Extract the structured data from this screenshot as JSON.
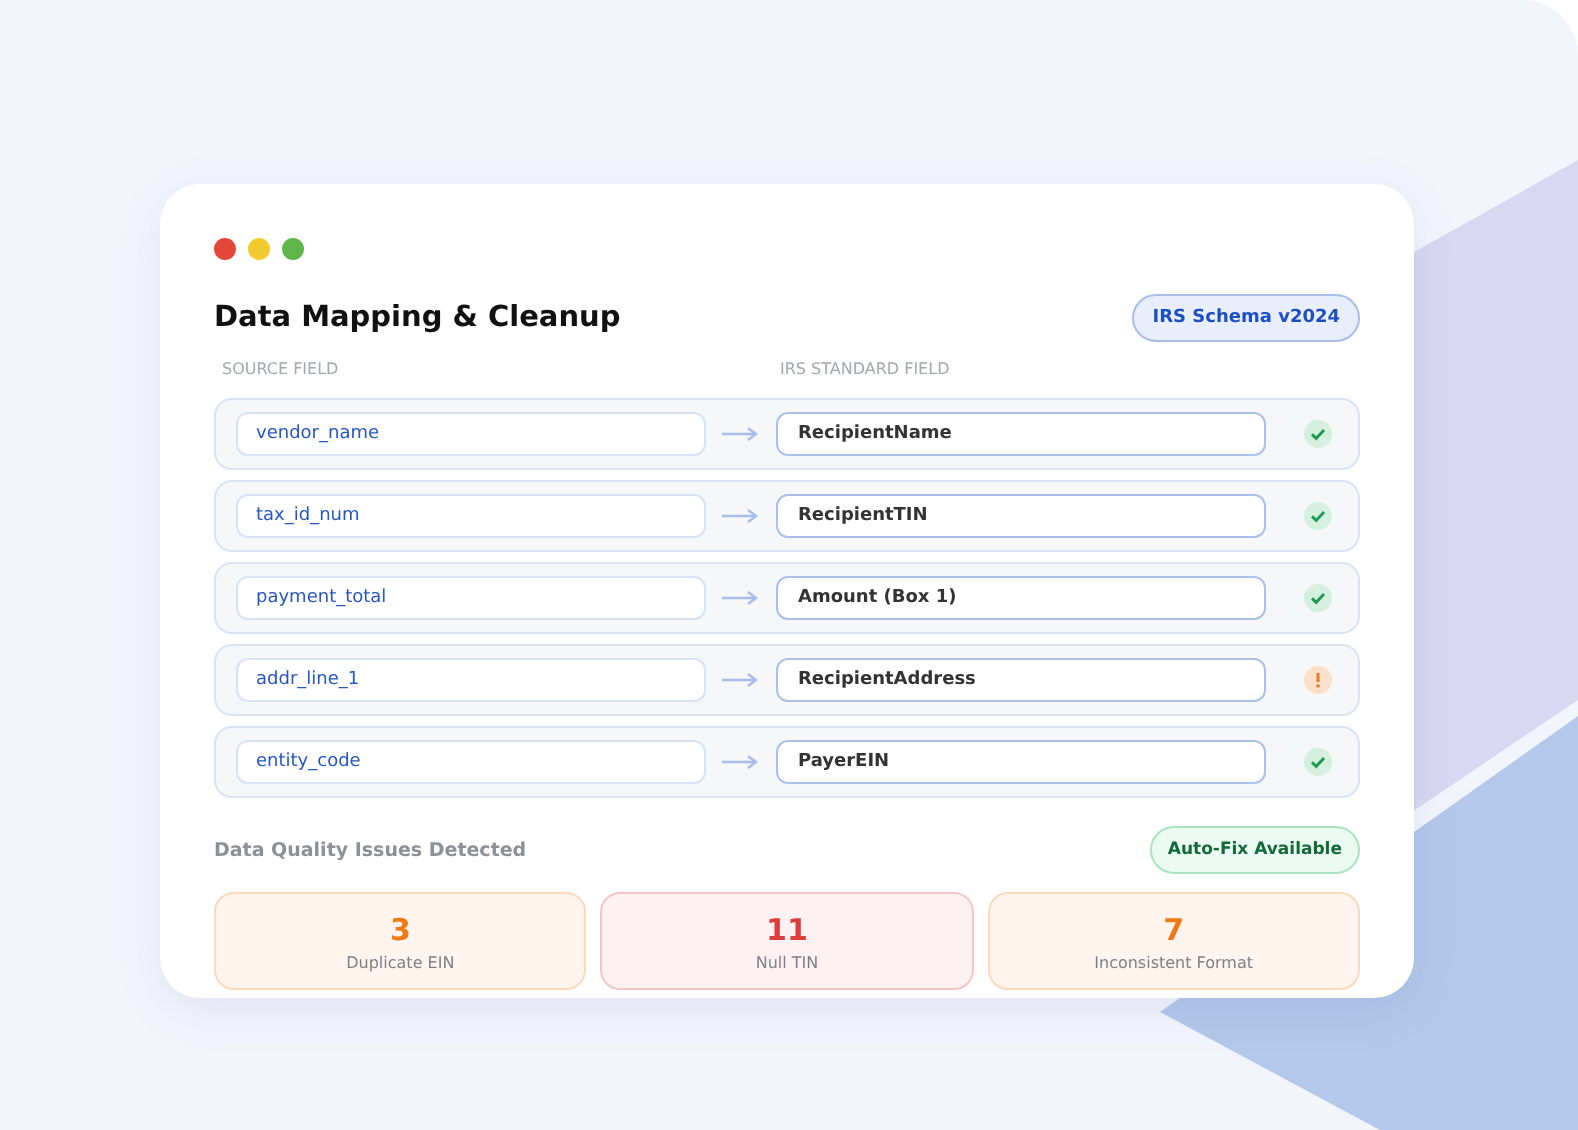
{
  "window": {
    "title": "Data Mapping & Cleanup",
    "badge": "IRS Schema v2024"
  },
  "columns": [
    "SOURCE FIELD",
    "IRS STANDARD FIELD"
  ],
  "mappings": [
    {
      "source": "vendor_name",
      "target": "RecipientName",
      "kind": "ok"
    },
    {
      "source": "tax_id_num",
      "target": "RecipientTIN",
      "kind": "ok"
    },
    {
      "source": "payment_total",
      "target": "Amount (Box 1)",
      "kind": "ok"
    },
    {
      "source": "addr_line_1",
      "target": "RecipientAddress",
      "kind": "warning"
    },
    {
      "source": "entity_code",
      "target": "PayerEIN",
      "kind": "ok"
    }
  ],
  "issues": {
    "title": "Data Quality Issues Detected",
    "action": "Auto-Fix Available",
    "items": [
      {
        "count": "3",
        "label": "Duplicate EIN",
        "kind": "warning"
      },
      {
        "count": "11",
        "label": "Null TIN",
        "kind": "error"
      },
      {
        "count": "7",
        "label": "Inconsistent Format",
        "kind": "warning"
      }
    ]
  }
}
